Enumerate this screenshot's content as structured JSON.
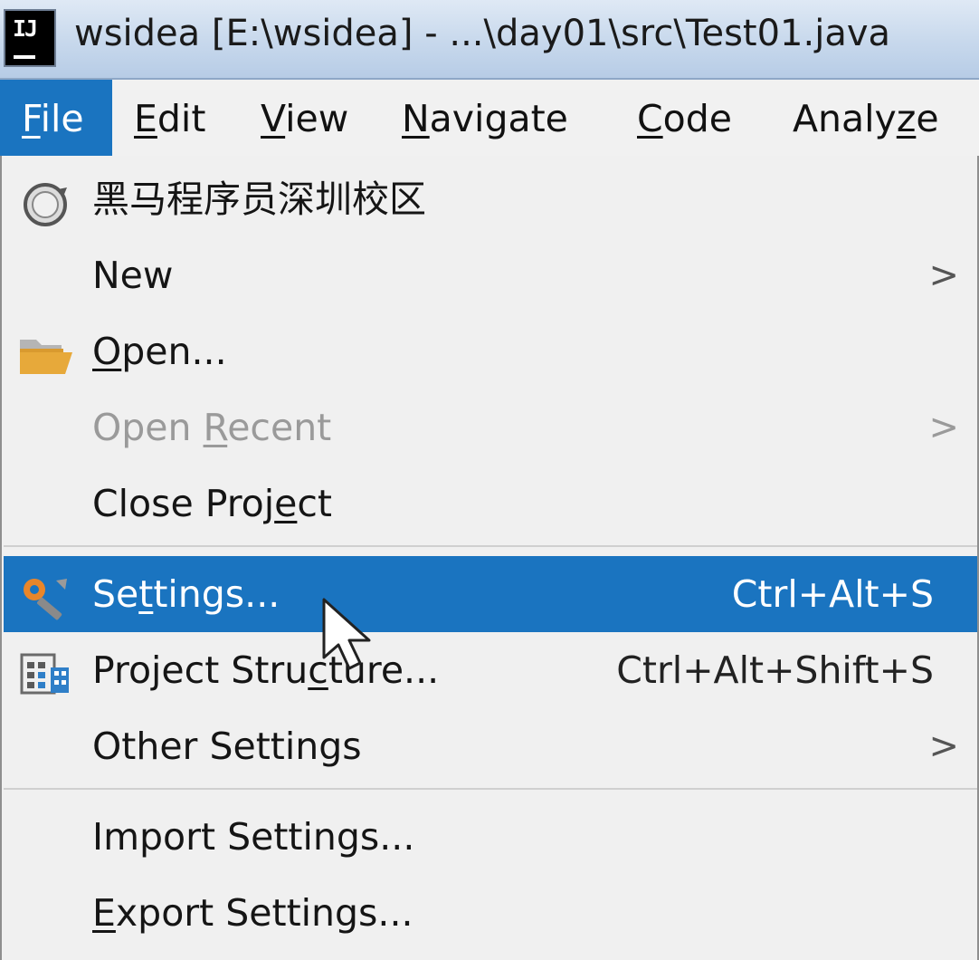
{
  "window": {
    "title": "wsidea [E:\\wsidea] - ...\\day01\\src\\Test01.java",
    "app_icon_text": "IJ"
  },
  "menubar": {
    "items": [
      {
        "pre": "",
        "mn": "F",
        "post": "ile"
      },
      {
        "pre": "",
        "mn": "E",
        "post": "dit"
      },
      {
        "pre": "",
        "mn": "V",
        "post": "iew"
      },
      {
        "pre": "",
        "mn": "N",
        "post": "avigate"
      },
      {
        "pre": "",
        "mn": "C",
        "post": "ode"
      },
      {
        "pre": "Analy",
        "mn": "z",
        "post": "e"
      }
    ],
    "active_index": 0
  },
  "file_menu": {
    "items": [
      {
        "pre": "黑马程序员深圳校区",
        "mn": "",
        "post": "",
        "icon": "circle-arrow-icon"
      },
      {
        "pre": "New",
        "mn": "",
        "post": "",
        "submenu": ">"
      },
      {
        "pre": "",
        "mn": "O",
        "post": "pen...",
        "icon": "folder-icon"
      },
      {
        "pre": "Open ",
        "mn": "R",
        "post": "ecent",
        "submenu": ">",
        "disabled": true
      },
      {
        "pre": "Close Proj",
        "mn": "e",
        "post": "ct"
      },
      {
        "pre": "Se",
        "mn": "t",
        "post": "tings...",
        "shortcut": "Ctrl+Alt+S",
        "icon": "wrench-settings-icon",
        "selected": true
      },
      {
        "pre": "Project Stru",
        "mn": "c",
        "post": "ture...",
        "shortcut": "Ctrl+Alt+Shift+S",
        "icon": "project-structure-icon"
      },
      {
        "pre": "Other Settings",
        "mn": "",
        "post": "",
        "submenu": ">"
      },
      {
        "pre": "Import Settings...",
        "mn": "",
        "post": ""
      },
      {
        "pre": "",
        "mn": "E",
        "post": "xport Settings..."
      }
    ]
  },
  "colors": {
    "accent": "#1a74c0",
    "menu_bg": "#f0f0f0",
    "disabled_text": "#9a9a9a",
    "folder": "#e7a93a",
    "wrench": "#e8862a"
  }
}
